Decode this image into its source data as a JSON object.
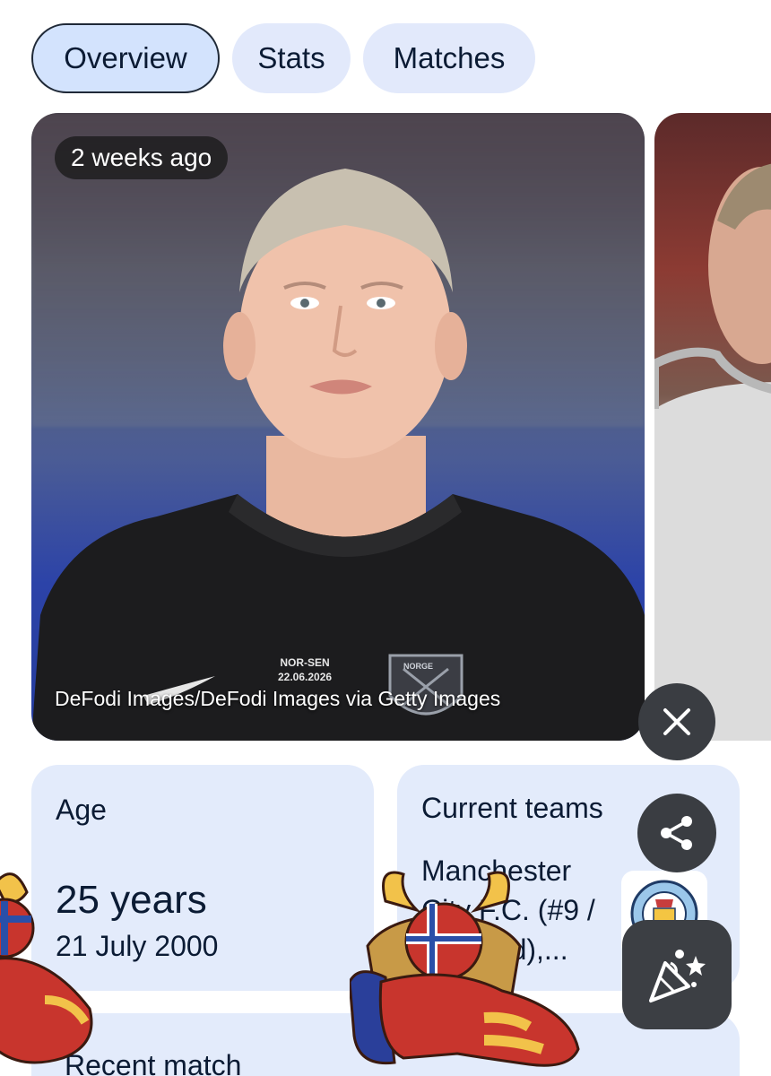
{
  "tabs": [
    {
      "label": "Overview",
      "active": true
    },
    {
      "label": "Stats",
      "active": false
    },
    {
      "label": "Matches",
      "active": false
    }
  ],
  "hero": {
    "time_badge": "2 weeks ago",
    "credit": "DeFodi Images/DeFodi Images via Getty Images",
    "jersey_text": [
      "NOR-SEN",
      "22.06.2026"
    ],
    "crest_text": "NORGE"
  },
  "cards": {
    "age": {
      "title": "Age",
      "value": "25 years",
      "date": "21 July 2000"
    },
    "teams": {
      "title": "Current teams",
      "value": "Manchester City F.C. (#9 / Forward),...",
      "logo_text": "MANCHESTER CITY"
    },
    "recent": {
      "title": "Recent match"
    }
  },
  "buttons": {
    "close_icon": "close-icon",
    "share_icon": "share-icon",
    "party_icon": "party-popper-icon"
  },
  "colors": {
    "tab_bg": "#e2e9fb",
    "tab_active_bg": "#d3e3fd",
    "card_bg": "#e3ebfb",
    "fab_bg": "#3a3d42"
  }
}
